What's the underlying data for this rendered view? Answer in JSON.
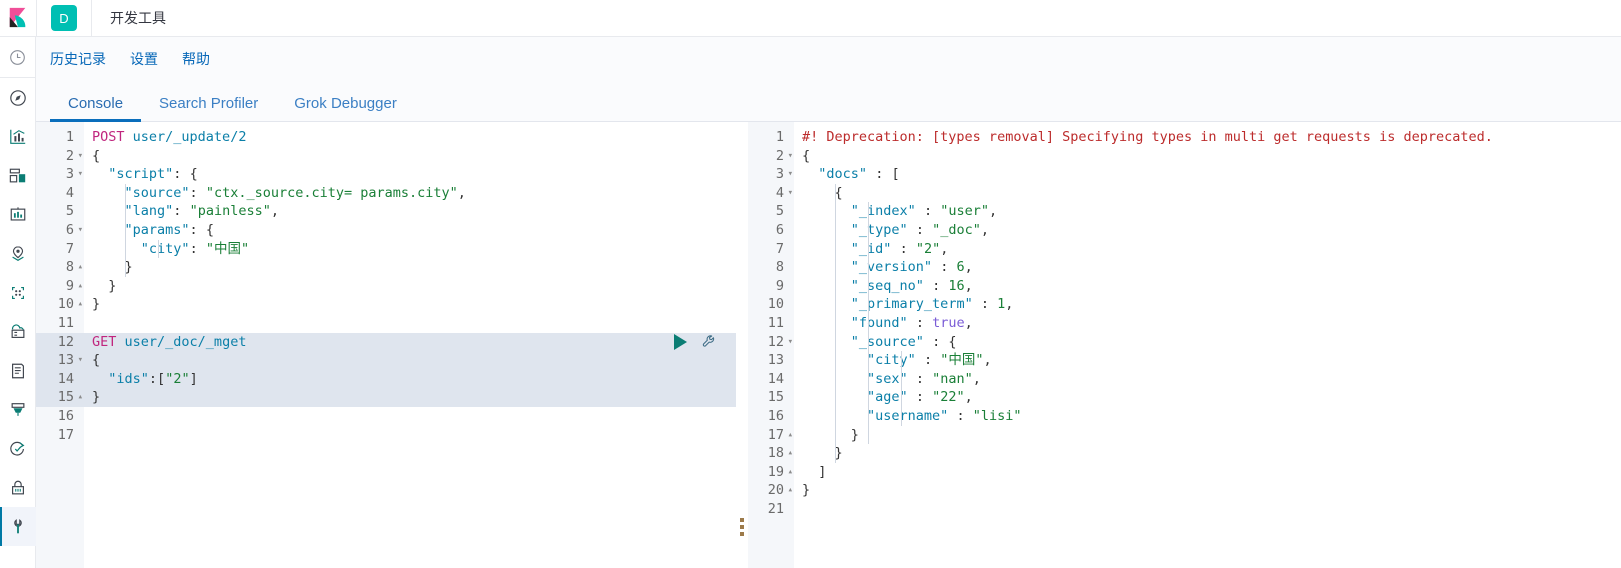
{
  "header": {
    "logo_name": "kibana-logo",
    "app_badge": "D",
    "app_title": "开发工具"
  },
  "sidebar": {
    "items": [
      {
        "icon": "clock-icon",
        "name": "recently-viewed"
      },
      {
        "icon": "compass-icon",
        "name": "discover"
      },
      {
        "icon": "bar-chart-icon",
        "name": "visualize"
      },
      {
        "icon": "dashboard-icon",
        "name": "dashboard"
      },
      {
        "icon": "canvas-icon",
        "name": "canvas"
      },
      {
        "icon": "map-pin-icon",
        "name": "maps"
      },
      {
        "icon": "machine-learning-icon",
        "name": "machine-learning"
      },
      {
        "icon": "infrastructure-icon",
        "name": "infrastructure"
      },
      {
        "icon": "logs-icon",
        "name": "logs"
      },
      {
        "icon": "apm-icon",
        "name": "apm"
      },
      {
        "icon": "uptime-icon",
        "name": "uptime"
      },
      {
        "icon": "lock-icon",
        "name": "siem"
      },
      {
        "icon": "wrench-icon",
        "name": "dev-tools",
        "selected": true
      }
    ]
  },
  "menu": {
    "items": [
      {
        "label": "历史记录"
      },
      {
        "label": "设置"
      },
      {
        "label": "帮助"
      }
    ]
  },
  "tabs": [
    {
      "label": "Console",
      "active": true
    },
    {
      "label": "Search Profiler",
      "active": false
    },
    {
      "label": "Grok Debugger",
      "active": false
    }
  ],
  "editor": {
    "request_line_count": 17,
    "highlighted_lines": [
      12,
      13,
      14,
      15
    ],
    "fold_markers": {
      "2": "open",
      "3": "open",
      "6": "open",
      "8": "close",
      "9": "close",
      "10": "close",
      "13": "open",
      "15": "close"
    },
    "lines": [
      {
        "n": 1,
        "text": "POST user/_update/2"
      },
      {
        "n": 2,
        "text": "{"
      },
      {
        "n": 3,
        "text": "  \"script\": {"
      },
      {
        "n": 4,
        "text": "    \"source\": \"ctx._source.city= params.city\","
      },
      {
        "n": 5,
        "text": "    \"lang\": \"painless\","
      },
      {
        "n": 6,
        "text": "    \"params\": {"
      },
      {
        "n": 7,
        "text": "      \"city\": \"中国\""
      },
      {
        "n": 8,
        "text": "    }"
      },
      {
        "n": 9,
        "text": "  }"
      },
      {
        "n": 10,
        "text": "}"
      },
      {
        "n": 11,
        "text": ""
      },
      {
        "n": 12,
        "text": "GET user/_doc/_mget"
      },
      {
        "n": 13,
        "text": "{"
      },
      {
        "n": 14,
        "text": "  \"ids\":[\"2\"]"
      },
      {
        "n": 15,
        "text": "}"
      },
      {
        "n": 16,
        "text": ""
      },
      {
        "n": 17,
        "text": ""
      }
    ],
    "actions": {
      "play_label": "send-request",
      "wrench_label": "request-options"
    }
  },
  "response": {
    "line_count": 21,
    "fold_markers": {
      "2": "open",
      "3": "open",
      "4": "open",
      "12": "open",
      "17": "close",
      "18": "close",
      "19": "close",
      "20": "close"
    },
    "lines": [
      {
        "n": 1,
        "text": "#! Deprecation: [types removal] Specifying types in multi get requests is deprecated."
      },
      {
        "n": 2,
        "text": "{"
      },
      {
        "n": 3,
        "text": "  \"docs\" : ["
      },
      {
        "n": 4,
        "text": "    {"
      },
      {
        "n": 5,
        "text": "      \"_index\" : \"user\","
      },
      {
        "n": 6,
        "text": "      \"_type\" : \"_doc\","
      },
      {
        "n": 7,
        "text": "      \"_id\" : \"2\","
      },
      {
        "n": 8,
        "text": "      \"_version\" : 6,"
      },
      {
        "n": 9,
        "text": "      \"_seq_no\" : 16,"
      },
      {
        "n": 10,
        "text": "      \"_primary_term\" : 1,"
      },
      {
        "n": 11,
        "text": "      \"found\" : true,"
      },
      {
        "n": 12,
        "text": "      \"_source\" : {"
      },
      {
        "n": 13,
        "text": "        \"city\" : \"中国\","
      },
      {
        "n": 14,
        "text": "        \"sex\" : \"nan\","
      },
      {
        "n": 15,
        "text": "        \"age\" : \"22\","
      },
      {
        "n": 16,
        "text": "        \"username\" : \"lisi\""
      },
      {
        "n": 17,
        "text": "      }"
      },
      {
        "n": 18,
        "text": "    }"
      },
      {
        "n": 19,
        "text": "  ]"
      },
      {
        "n": 20,
        "text": "}"
      },
      {
        "n": 21,
        "text": ""
      }
    ]
  },
  "colors": {
    "accent_teal": "#00BFB3",
    "accent_pink": "#F04E98",
    "link_blue": "#0868b8",
    "tab_underline": "#0a6ebc",
    "warning_red": "#bc2c2c",
    "string_green": "#1a7f37",
    "key_blue": "#0b7fa8",
    "method_pink": "#c0267e"
  }
}
